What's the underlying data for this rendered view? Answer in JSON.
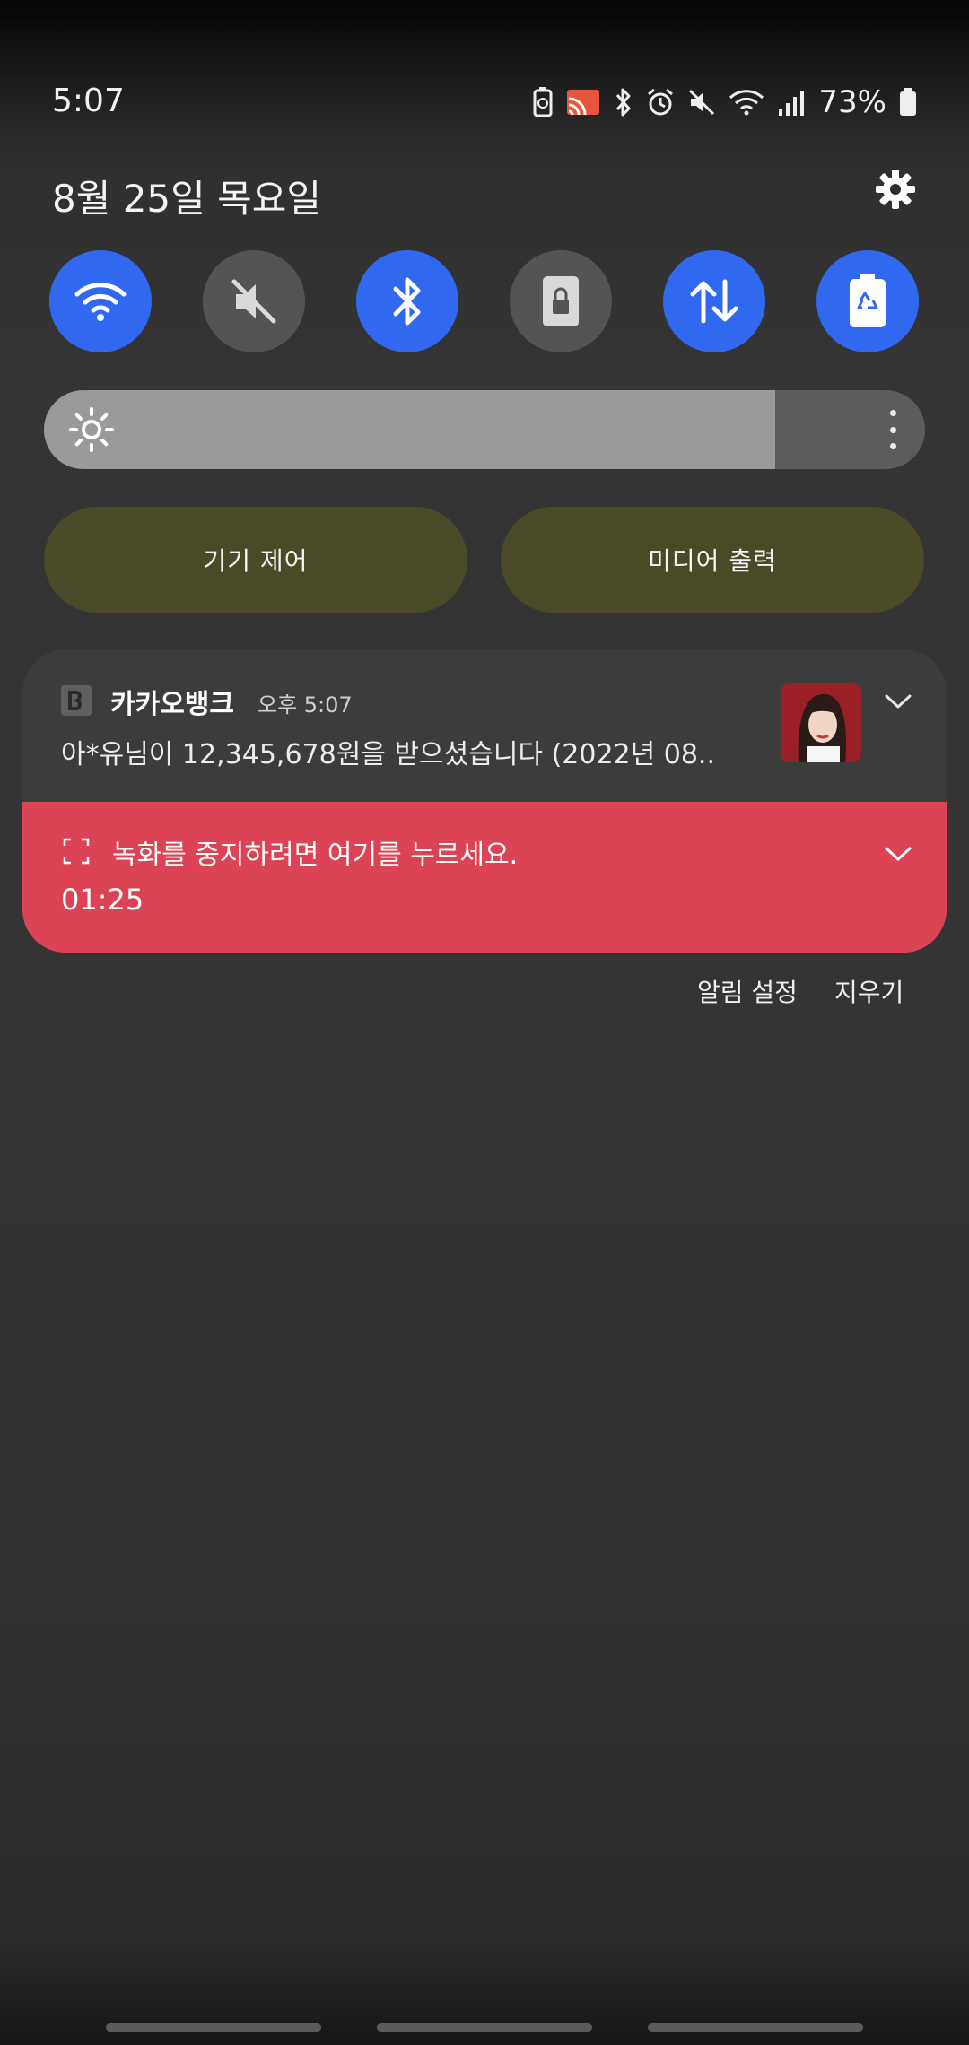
{
  "status_bar": {
    "time": "5:07",
    "battery_percent": "73%",
    "icons": [
      "battery-saver-icon",
      "cast-icon",
      "bluetooth-icon",
      "alarm-icon",
      "mute-icon",
      "wifi-icon",
      "signal-icon",
      "battery-icon"
    ]
  },
  "header": {
    "date": "8월 25일 목요일",
    "settings_icon": "gear-icon"
  },
  "quick_tiles": [
    {
      "icon": "wifi-icon",
      "state": "on"
    },
    {
      "icon": "mute-icon",
      "state": "off"
    },
    {
      "icon": "bluetooth-icon",
      "state": "on"
    },
    {
      "icon": "rotation-lock-icon",
      "state": "off"
    },
    {
      "icon": "mobile-data-icon",
      "state": "on"
    },
    {
      "icon": "power-saving-icon",
      "state": "on"
    }
  ],
  "brightness": {
    "level_percent": 83
  },
  "pills": {
    "device_control": "기기 제어",
    "media_output": "미디어 출력"
  },
  "notification": {
    "app_name": "카카오뱅크",
    "time": "오후 5:07",
    "body": "아*유님이 12,345,678원을 받으셨습니다 (2022년 08.."
  },
  "recording": {
    "text": "녹화를 중지하려면 여기를 누르세요.",
    "timer": "01:25"
  },
  "footer": {
    "notification_settings": "알림 설정",
    "clear": "지우기"
  },
  "colors": {
    "accent_blue": "#3168f0",
    "recording_red": "#dc4456",
    "pill_bg": "#4a4a27"
  }
}
